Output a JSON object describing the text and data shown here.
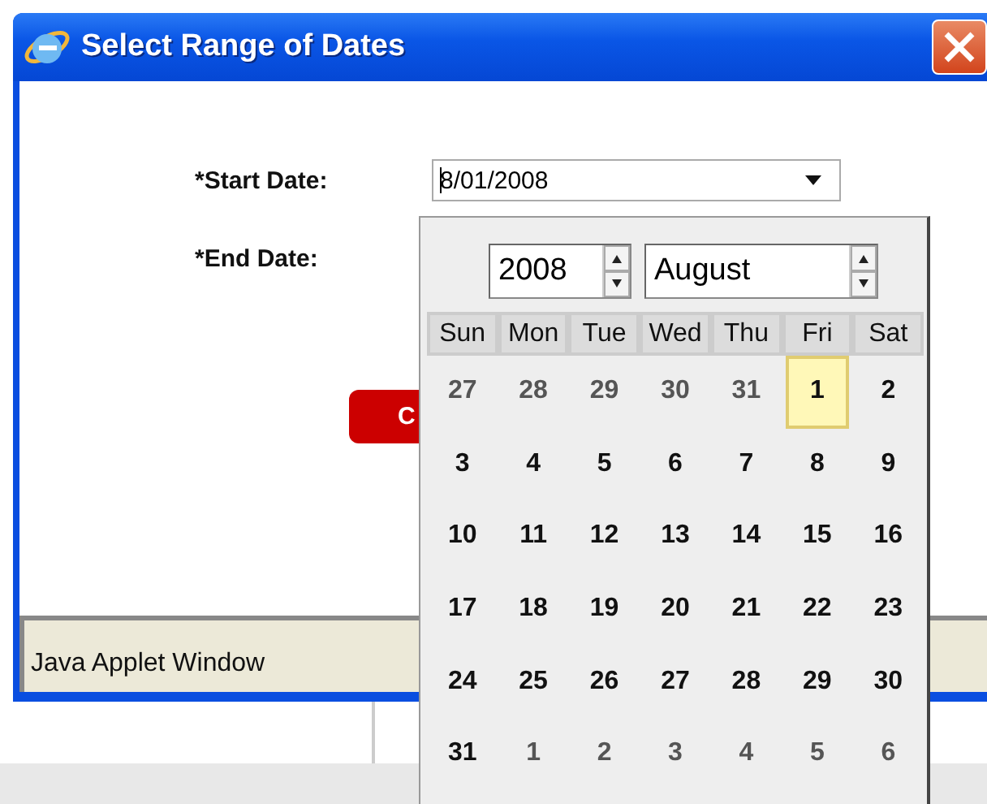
{
  "window": {
    "title": "Select Range of Dates"
  },
  "form": {
    "fields": [
      {
        "label": "*Start Date:",
        "value": "8/01/2008"
      },
      {
        "label": "*End Date:"
      }
    ],
    "button": {
      "label": "C"
    }
  },
  "calendar": {
    "year": "2008",
    "month": "August",
    "weekdays": [
      "Sun",
      "Mon",
      "Tue",
      "Wed",
      "Thu",
      "Fri",
      "Sat"
    ],
    "weeks": [
      [
        {
          "day": "27",
          "other_month": true,
          "selected": false
        },
        {
          "day": "28",
          "other_month": true,
          "selected": false
        },
        {
          "day": "29",
          "other_month": true,
          "selected": false
        },
        {
          "day": "30",
          "other_month": true,
          "selected": false
        },
        {
          "day": "31",
          "other_month": true,
          "selected": false
        },
        {
          "day": "1",
          "other_month": false,
          "selected": true
        },
        {
          "day": "2",
          "other_month": false,
          "selected": false
        }
      ],
      [
        {
          "day": "3",
          "other_month": false,
          "selected": false
        },
        {
          "day": "4",
          "other_month": false,
          "selected": false
        },
        {
          "day": "5",
          "other_month": false,
          "selected": false
        },
        {
          "day": "6",
          "other_month": false,
          "selected": false
        },
        {
          "day": "7",
          "other_month": false,
          "selected": false
        },
        {
          "day": "8",
          "other_month": false,
          "selected": false
        },
        {
          "day": "9",
          "other_month": false,
          "selected": false
        }
      ],
      [
        {
          "day": "10",
          "other_month": false,
          "selected": false
        },
        {
          "day": "11",
          "other_month": false,
          "selected": false
        },
        {
          "day": "12",
          "other_month": false,
          "selected": false
        },
        {
          "day": "13",
          "other_month": false,
          "selected": false
        },
        {
          "day": "14",
          "other_month": false,
          "selected": false
        },
        {
          "day": "15",
          "other_month": false,
          "selected": false
        },
        {
          "day": "16",
          "other_month": false,
          "selected": false
        }
      ],
      [
        {
          "day": "17",
          "other_month": false,
          "selected": false
        },
        {
          "day": "18",
          "other_month": false,
          "selected": false
        },
        {
          "day": "19",
          "other_month": false,
          "selected": false
        },
        {
          "day": "20",
          "other_month": false,
          "selected": false
        },
        {
          "day": "21",
          "other_month": false,
          "selected": false
        },
        {
          "day": "22",
          "other_month": false,
          "selected": false
        },
        {
          "day": "23",
          "other_month": false,
          "selected": false
        }
      ],
      [
        {
          "day": "24",
          "other_month": false,
          "selected": false
        },
        {
          "day": "25",
          "other_month": false,
          "selected": false
        },
        {
          "day": "26",
          "other_month": false,
          "selected": false
        },
        {
          "day": "27",
          "other_month": false,
          "selected": false
        },
        {
          "day": "28",
          "other_month": false,
          "selected": false
        },
        {
          "day": "29",
          "other_month": false,
          "selected": false
        },
        {
          "day": "30",
          "other_month": false,
          "selected": false
        }
      ],
      [
        {
          "day": "31",
          "other_month": false,
          "selected": false
        },
        {
          "day": "1",
          "other_month": true,
          "selected": false
        },
        {
          "day": "2",
          "other_month": true,
          "selected": false
        },
        {
          "day": "3",
          "other_month": true,
          "selected": false
        },
        {
          "day": "4",
          "other_month": true,
          "selected": false
        },
        {
          "day": "5",
          "other_month": true,
          "selected": false
        },
        {
          "day": "6",
          "other_month": true,
          "selected": false
        }
      ]
    ]
  },
  "status_bar": {
    "text": "Java Applet Window"
  }
}
